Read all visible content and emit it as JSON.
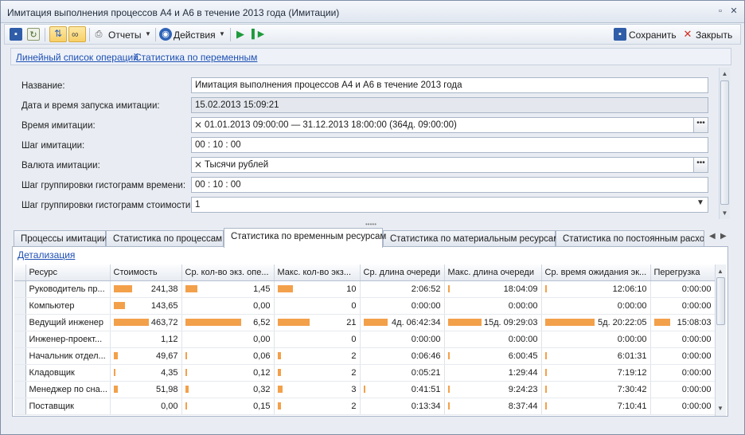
{
  "window": {
    "title": "Имитация выполнения процессов А4 и А6 в течение 2013 года (Имитации)"
  },
  "toolbar": {
    "reports_label": "Отчеты",
    "actions_label": "Действия",
    "save_label": "Сохранить",
    "close_label": "Закрыть"
  },
  "links": {
    "ops_list": "Линейный список операций",
    "var_stats": "Статистика по переменным"
  },
  "form": {
    "name_label": "Название:",
    "name_value": "Имитация выполнения процессов А4 и А6 в течение 2013 года",
    "start_label": "Дата и время запуска имитации:",
    "start_value": "15.02.2013 15:09:21",
    "time_label": "Время имитации:",
    "time_value": "01.01.2013 09:00:00 — 31.12.2013 18:00:00 (364д. 09:00:00)",
    "step_label": "Шаг имитации:",
    "step_value": "00 : 10 : 00",
    "currency_label": "Валюта имитации:",
    "currency_value": "Тысячи рублей",
    "hist_time_label": "Шаг группировки гистограмм времени:",
    "hist_time_value": "00 : 10 : 00",
    "hist_cost_label": "Шаг группировки гистограмм стоимости:",
    "hist_cost_value": "1"
  },
  "tabs": [
    "Процессы имитации",
    "Статистика по процессам",
    "Статистика по временным ресурсам",
    "Статистика по материальным ресурсам",
    "Статистика по постоянным расход"
  ],
  "detail_link": "Детализация",
  "grid": {
    "columns": [
      "Ресурс",
      "Стоимость",
      "Ср. кол-во экз. опе...",
      "Макс. кол-во экз...",
      "Ср. длина очереди",
      "Макс. длина очереди",
      "Ср. время ожидания эк...",
      "Перегрузка"
    ],
    "bar_color": "#f3a04a",
    "rows": [
      {
        "name": "Руководитель пр...",
        "cost": "241,38",
        "cost_f": 0.52,
        "avg": "1,45",
        "avg_f": 0.22,
        "max": "10",
        "max_f": 0.48,
        "avgq": "2:06:52",
        "avgq_f": 0.0,
        "maxq": "18:04:09",
        "maxq_f": 0.03,
        "wait": "12:06:10",
        "wait_f": 0.04,
        "over": "0:00:00",
        "over_f": 0.0
      },
      {
        "name": "Компьютер",
        "cost": "143,65",
        "cost_f": 0.31,
        "avg": "0,00",
        "avg_f": 0.0,
        "max": "0",
        "max_f": 0.0,
        "avgq": "0:00:00",
        "avgq_f": 0.0,
        "maxq": "0:00:00",
        "maxq_f": 0.0,
        "wait": "0:00:00",
        "wait_f": 0.0,
        "over": "0:00:00",
        "over_f": 0.0
      },
      {
        "name": "Ведущий инженер",
        "cost": "463,72",
        "cost_f": 1.0,
        "avg": "6,52",
        "avg_f": 1.0,
        "max": "21",
        "max_f": 1.0,
        "avgq": "4д. 06:42:34",
        "avgq_f": 1.0,
        "maxq": "15д. 09:29:03",
        "maxq_f": 1.0,
        "wait": "5д. 20:22:05",
        "wait_f": 1.0,
        "over": "15:08:03",
        "over_f": 1.0
      },
      {
        "name": "Инженер-проект...",
        "cost": "1,12",
        "cost_f": 0.0,
        "avg": "0,00",
        "avg_f": 0.0,
        "max": "0",
        "max_f": 0.0,
        "avgq": "0:00:00",
        "avgq_f": 0.0,
        "maxq": "0:00:00",
        "maxq_f": 0.0,
        "wait": "0:00:00",
        "wait_f": 0.0,
        "over": "0:00:00",
        "over_f": 0.0
      },
      {
        "name": "Начальник отдел...",
        "cost": "49,67",
        "cost_f": 0.11,
        "avg": "0,06",
        "avg_f": 0.01,
        "max": "2",
        "max_f": 0.1,
        "avgq": "0:06:46",
        "avgq_f": 0.0,
        "maxq": "6:00:45",
        "maxq_f": 0.02,
        "wait": "6:01:31",
        "wait_f": 0.02,
        "over": "0:00:00",
        "over_f": 0.0
      },
      {
        "name": "Кладовщик",
        "cost": "4,35",
        "cost_f": 0.01,
        "avg": "0,12",
        "avg_f": 0.02,
        "max": "2",
        "max_f": 0.1,
        "avgq": "0:05:21",
        "avgq_f": 0.0,
        "maxq": "1:29:44",
        "maxq_f": 0.0,
        "wait": "7:19:12",
        "wait_f": 0.02,
        "over": "0:00:00",
        "over_f": 0.0
      },
      {
        "name": "Менеджер по сна...",
        "cost": "51,98",
        "cost_f": 0.11,
        "avg": "0,32",
        "avg_f": 0.05,
        "max": "3",
        "max_f": 0.14,
        "avgq": "0:41:51",
        "avgq_f": 0.01,
        "maxq": "9:24:23",
        "maxq_f": 0.03,
        "wait": "7:30:42",
        "wait_f": 0.02,
        "over": "0:00:00",
        "over_f": 0.0
      },
      {
        "name": "Поставщик",
        "cost": "0,00",
        "cost_f": 0.0,
        "avg": "0,15",
        "avg_f": 0.02,
        "max": "2",
        "max_f": 0.1,
        "avgq": "0:13:34",
        "avgq_f": 0.0,
        "maxq": "8:37:44",
        "maxq_f": 0.02,
        "wait": "7:10:41",
        "wait_f": 0.02,
        "over": "0:00:00",
        "over_f": 0.0
      }
    ]
  }
}
